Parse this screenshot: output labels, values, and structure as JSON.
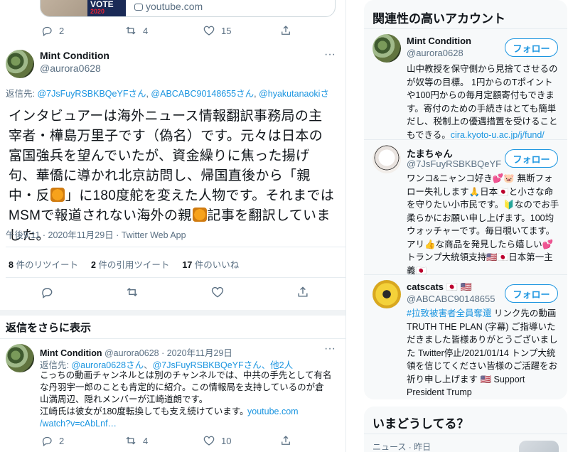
{
  "previous_tweet": {
    "link_domain": "youtube.com",
    "thumb_text": "VOTE 2020",
    "actions": {
      "replies": "2",
      "retweets": "4",
      "likes": "15"
    }
  },
  "main_tweet": {
    "author_name": "Mint Condition",
    "author_handle": "@aurora0628",
    "reply_prefix": "返信先: ",
    "reply_to": [
      "@7JsFuyRSBKBQeYFさん",
      "@ABCABC90148655さん",
      "@hyakutanaokiさ"
    ],
    "text_parts": [
      "インタビュアーは海外ニュース情報翻訳事務局の主宰者・樺島万里子です（偽名）です。元々は日本の富国強兵を望んでいたが、資金繰りに焦った揚げ句、華僑に導かれ北京訪問し、帰国直後から「親中・反",
      "」に180度舵を変えた人物です。それまではMSMで報道されない海外の親",
      "記事を翻訳していました。"
    ],
    "timestamp": "午後9:11 · 2020年11月29日 · Twitter Web App",
    "stats": {
      "retweets_count": "8",
      "retweets_label": "件のリツイート",
      "quotes_count": "2",
      "quotes_label": "件の引用ツイート",
      "likes_count": "17",
      "likes_label": "件のいいね"
    }
  },
  "show_more_replies": "返信をさらに表示",
  "reply_tweet": {
    "author_name": "Mint Condition",
    "author_handle": "@aurora0628",
    "date": "· 2020年11月29日",
    "reply_prefix": "返信先: ",
    "reply_to_1": "@aurora0628さん",
    "reply_to_sep": "、",
    "reply_to_2": "@7JsFuyRSBKBQeYFさん",
    "reply_to_more": "、他2人",
    "text": "こっちの動画チャンネルとは別のチャンネルでは、中共の手先として有名な丹羽宇一郎のことも肯定的に紹介。この情報局を支持しているのが倉山満周辺、隠れメンバーが江崎道朗です。\n江崎氏は彼女が180度転換しても支え続けています。",
    "link_1": "youtube.com",
    "link_2": "/watch?v=cAbLnf…",
    "actions": {
      "replies": "2",
      "retweets": "4",
      "likes": "10"
    }
  },
  "sidebar": {
    "related_title": "関連性の高いアカウント",
    "follow_label": "フォロー",
    "accounts": [
      {
        "name": "Mint Condition",
        "handle": "@aurora0628",
        "bio": "山中教授を保守側から見捨てさせるのが奴等の目標。 1円からのTポイントや100円からの毎月定額寄付もできます。寄付のための手続きはとても簡単だし、税制上の優遇措置を受けることもできる。",
        "bio_link": "cira.kyoto-u.ac.jp/j/fund/"
      },
      {
        "name": "たまちゃん",
        "handle": "@7JsFuyRSBKBQeYF",
        "bio": "ワンコ&ニャンコ好き💕🐷 無断フォロー失礼します🙏日本🇯🇵と小さな命を守りたい小市民です。🔰なのでお手柔らかにお願い申し上げます。100均ウォッチャーです。毎日覗いてます。アリ👍な商品を発見したら嬉しい💕トランプ大統領支持🇺🇸🇯🇵日本第一主義🇯🇵"
      },
      {
        "name": "catscats",
        "name_flags": "🇯🇵 🇺🇸",
        "handle": "@ABCABC90148655",
        "bio_hashtag": "#拉致被害者全員奪還",
        "bio": " リンク先の動画TRUTH THE PLAN (字幕) ご指導いただきました皆様ありがとうございました Twitter停止/2021/01/14 トンプ大統領を信じてください皆様のご活躍をお祈り申し上げます 🇺🇸 Support President Trump"
      }
    ],
    "trends_title": "いまどうしてる？",
    "trend_meta": "ニュース · 昨日"
  },
  "colors": {
    "accent": "#1b95e0",
    "text": "#0f1419",
    "muted": "#5b7083",
    "border": "#e6ecf0",
    "panel_bg": "#f7f9fa"
  }
}
